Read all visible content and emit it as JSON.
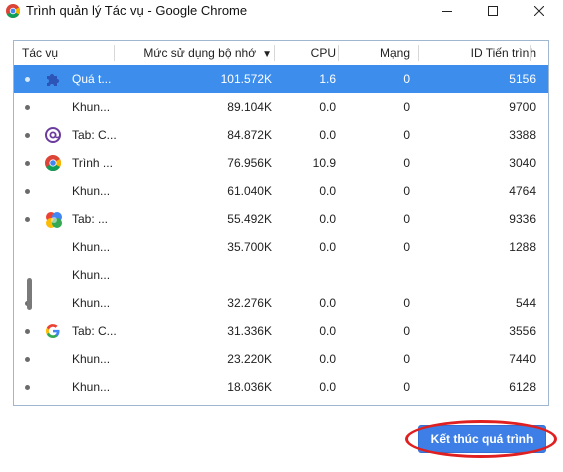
{
  "window": {
    "title": "Trình quản lý Tác vụ - Google Chrome",
    "app_icon": "chrome-icon",
    "controls": [
      "minimize-icon",
      "maximize-icon",
      "close-icon"
    ]
  },
  "table": {
    "columns": {
      "task": "Tác vụ",
      "memory": "Mức sử dụng bộ nhớ",
      "cpu": "CPU",
      "network": "Mạng",
      "pid": "ID Tiến trình"
    },
    "sort_indicator": "▼",
    "rows": [
      {
        "icon": "puzzle-extension-icon",
        "name": "Quá t...",
        "memory": "101.572K",
        "cpu": "1.6",
        "network": "0",
        "pid": "5156",
        "selected": true,
        "dot": true
      },
      {
        "icon": "",
        "name": "Khun...",
        "memory": "89.104K",
        "cpu": "0.0",
        "network": "0",
        "pid": "9700",
        "selected": false,
        "dot": true
      },
      {
        "icon": "purple-at-sign-icon",
        "name": "Tab: C...",
        "memory": "84.872K",
        "cpu": "0.0",
        "network": "0",
        "pid": "3388",
        "selected": false,
        "dot": true
      },
      {
        "icon": "chrome-icon",
        "name": "Trình ...",
        "memory": "76.956K",
        "cpu": "10.9",
        "network": "0",
        "pid": "3040",
        "selected": false,
        "dot": true
      },
      {
        "icon": "",
        "name": "Khun...",
        "memory": "61.040K",
        "cpu": "0.0",
        "network": "0",
        "pid": "4764",
        "selected": false,
        "dot": true
      },
      {
        "icon": "multicolor-circles-icon",
        "name": "Tab: ...",
        "memory": "55.492K",
        "cpu": "0.0",
        "network": "0",
        "pid": "9336",
        "selected": false,
        "dot": true
      },
      {
        "icon": "",
        "name": "Khun...",
        "memory": "35.700K",
        "cpu": "0.0",
        "network": "0",
        "pid": "1288",
        "selected": false,
        "dot": false
      },
      {
        "icon": "",
        "name": "Khun...",
        "memory": "",
        "cpu": "",
        "network": "",
        "pid": "",
        "selected": false,
        "dot": false
      },
      {
        "icon": "",
        "name": "Khun...",
        "memory": "32.276K",
        "cpu": "0.0",
        "network": "0",
        "pid": "544",
        "selected": false,
        "dot": true
      },
      {
        "icon": "google-g-icon",
        "name": "Tab: C...",
        "memory": "31.336K",
        "cpu": "0.0",
        "network": "0",
        "pid": "3556",
        "selected": false,
        "dot": true
      },
      {
        "icon": "",
        "name": "Khun...",
        "memory": "23.220K",
        "cpu": "0.0",
        "network": "0",
        "pid": "7440",
        "selected": false,
        "dot": true
      },
      {
        "icon": "",
        "name": "Khun...",
        "memory": "18.036K",
        "cpu": "0.0",
        "network": "0",
        "pid": "6128",
        "selected": false,
        "dot": true
      }
    ]
  },
  "footer": {
    "end_process_label": "Kết thúc quá trình"
  },
  "colors": {
    "selection": "#3d8eec",
    "button": "#3d7fe6",
    "highlight_ring": "#e02020"
  }
}
